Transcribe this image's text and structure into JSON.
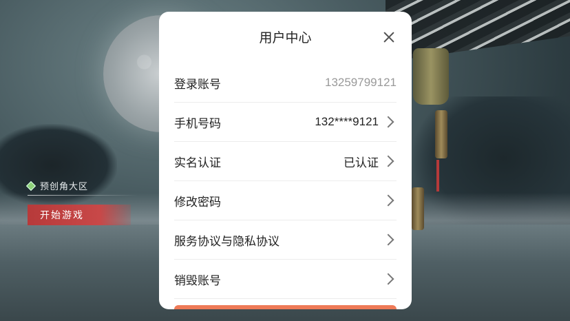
{
  "left_menu": {
    "server_name": "预创角大区",
    "start_button": "开始游戏"
  },
  "modal": {
    "title": "用户中心",
    "rows": [
      {
        "label": "登录账号",
        "value": "13259799121",
        "has_chevron": false
      },
      {
        "label": "手机号码",
        "value": "132****9121",
        "has_chevron": true
      },
      {
        "label": "实名认证",
        "value": "已认证",
        "has_chevron": true
      },
      {
        "label": "修改密码",
        "value": "",
        "has_chevron": true
      },
      {
        "label": "服务协议与隐私协议",
        "value": "",
        "has_chevron": true
      },
      {
        "label": "销毁账号",
        "value": "",
        "has_chevron": true
      }
    ]
  },
  "colors": {
    "accent": "#ee7a57",
    "start_button": "#c84848"
  },
  "icons": [
    "close-icon",
    "chevron-right-icon",
    "diamond-icon"
  ]
}
